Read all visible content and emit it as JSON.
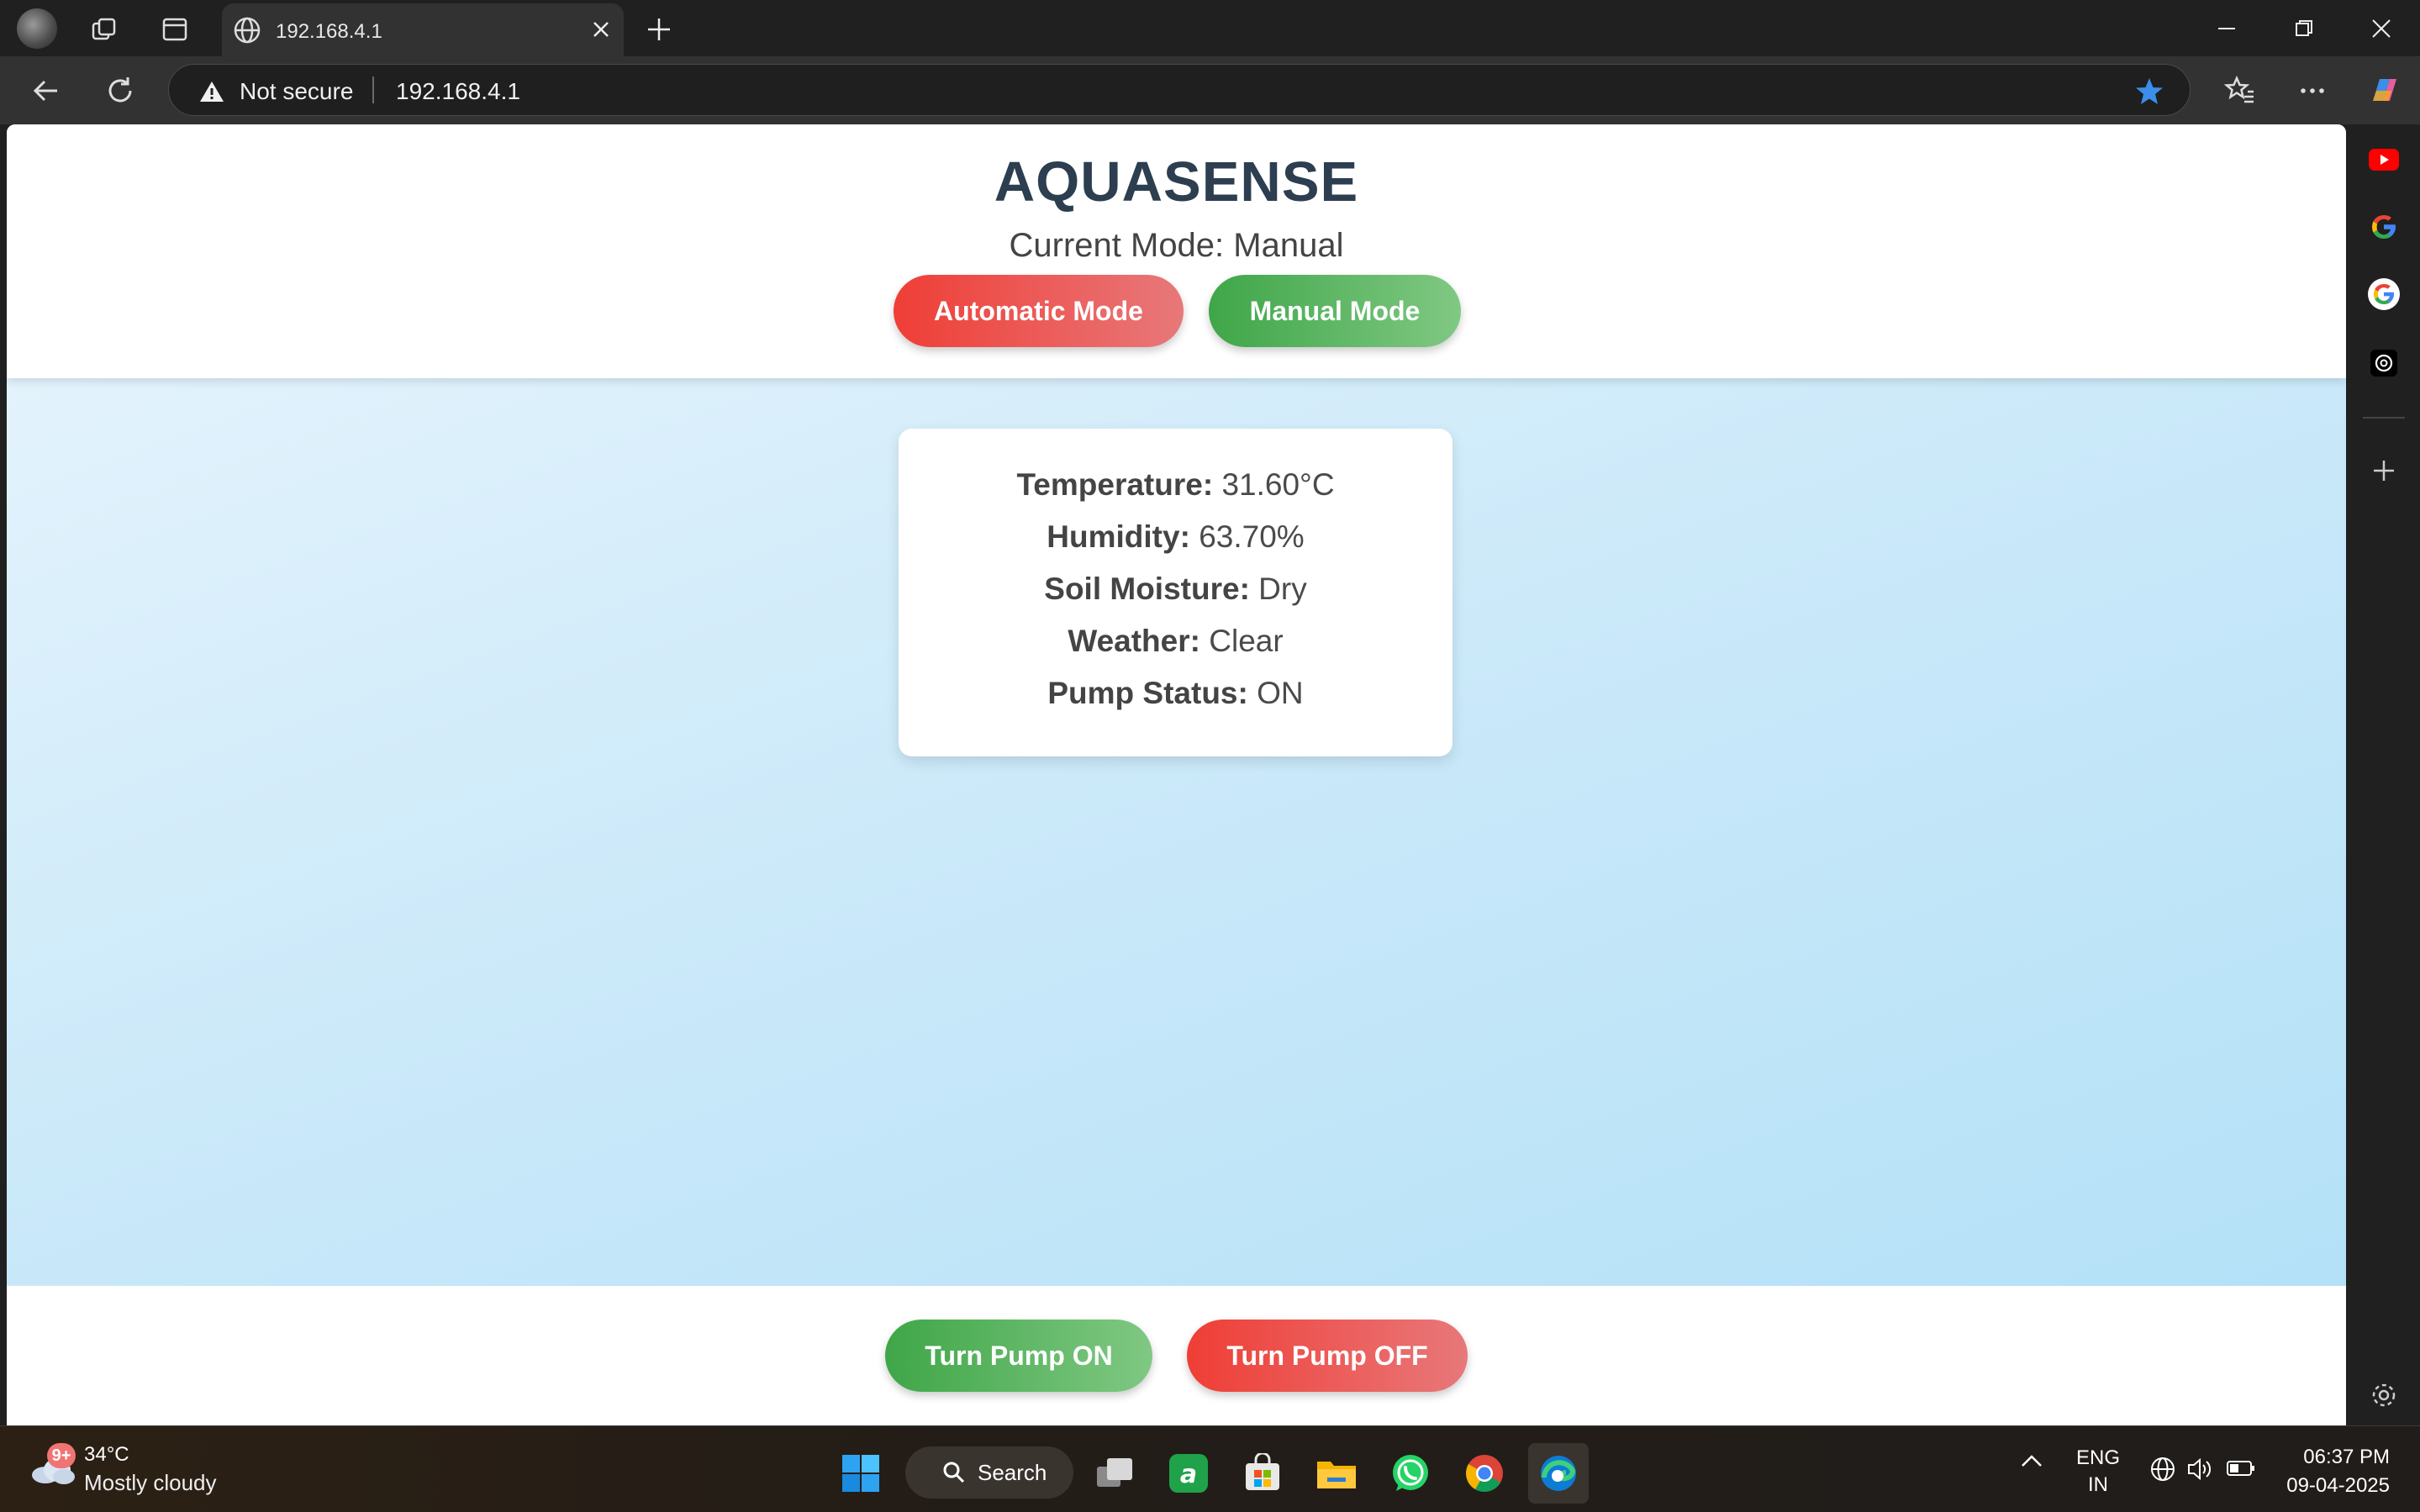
{
  "browser": {
    "tab_title": "192.168.4.1",
    "security_label": "Not secure",
    "url": "192.168.4.1"
  },
  "app": {
    "title": "AQUASENSE",
    "mode_prefix": "Current Mode: ",
    "mode_value": "Manual",
    "automatic_button": "Automatic Mode",
    "manual_button": "Manual Mode"
  },
  "sensors": [
    {
      "label": "Temperature:",
      "value": "31.60°C"
    },
    {
      "label": "Humidity:",
      "value": "63.70%"
    },
    {
      "label": "Soil Moisture:",
      "value": "Dry"
    },
    {
      "label": "Weather:",
      "value": "Clear"
    },
    {
      "label": "Pump Status:",
      "value": "ON"
    }
  ],
  "pump_controls": {
    "on_button": "Turn Pump ON",
    "off_button": "Turn Pump OFF"
  },
  "taskbar": {
    "weather_badge": "9+",
    "weather_temp": "34°C",
    "weather_condition": "Mostly cloudy",
    "search_label": "Search",
    "lang_top": "ENG",
    "lang_bottom": "IN",
    "time": "06:37 PM",
    "date": "09-04-2025"
  },
  "colors": {
    "title": "#2c3e50",
    "red_button": "#ef3e36",
    "green_button": "#3fa648",
    "content_bg": "#cbe9f9"
  }
}
